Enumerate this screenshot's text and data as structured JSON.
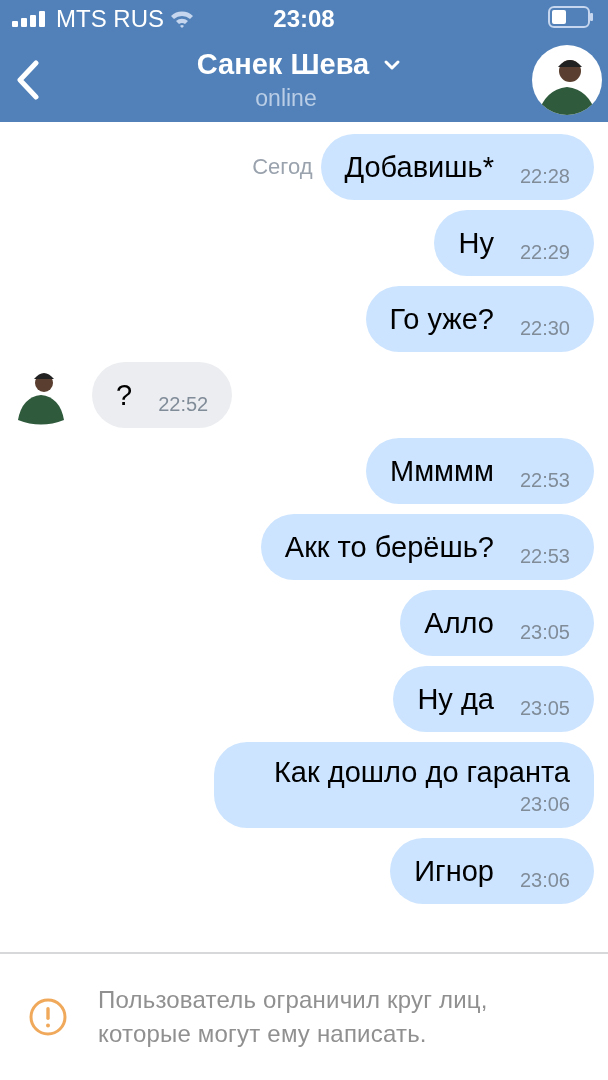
{
  "status_bar": {
    "carrier": "MTS RUS",
    "time": "23:08"
  },
  "header": {
    "name": "Санек Шева",
    "status": "online"
  },
  "date_separator": "Сегод",
  "messages": [
    {
      "kind": "out",
      "text": "Добавишь*",
      "time": "22:28"
    },
    {
      "kind": "out",
      "text": "Ну",
      "time": "22:29"
    },
    {
      "kind": "out",
      "text": "Го уже?",
      "time": "22:30"
    },
    {
      "kind": "in",
      "text": "?",
      "time": "22:52"
    },
    {
      "kind": "out",
      "text": "Ммммм",
      "time": "22:53"
    },
    {
      "kind": "out",
      "text": "Акк то берёшь?",
      "time": "22:53"
    },
    {
      "kind": "out",
      "text": "Алло",
      "time": "23:05"
    },
    {
      "kind": "out",
      "text": "Ну да",
      "time": "23:05"
    },
    {
      "kind": "out",
      "text": "Как дошло до гаранта",
      "time": "23:06"
    },
    {
      "kind": "out",
      "text": "Игнор",
      "time": "23:06"
    }
  ],
  "notice": "Пользователь ограничил круг лиц, которые могут ему написать."
}
